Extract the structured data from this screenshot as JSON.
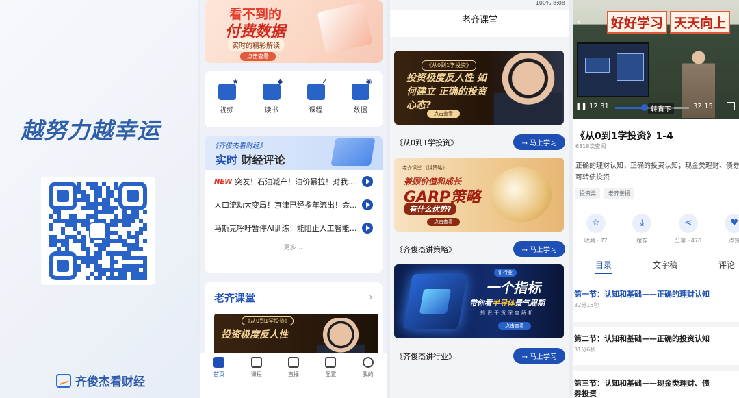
{
  "panel1": {
    "slogan": "越努力越幸运",
    "brand_name": "齐俊杰看财经"
  },
  "panel2": {
    "banner": {
      "line1": "看不到的",
      "line2": "付费数据",
      "line3": "实时的精彩解读",
      "button": "点击查看"
    },
    "icons": [
      {
        "label": "视频",
        "icon": "video-icon"
      },
      {
        "label": "读书",
        "icon": "book-icon"
      },
      {
        "label": "课程",
        "icon": "course-icon"
      },
      {
        "label": "数据",
        "icon": "data-icon"
      }
    ],
    "news": {
      "tag": "《齐俊杰看财经》",
      "title_highlight": "实时",
      "title_rest": "财经评论",
      "new_badge": "NEW",
      "items": [
        "突发！石油减产！油价暴拉！对我...",
        "人口流动大变局！京津已经多年流出！会...",
        "马斯克呼吁暂停AI训练！能阻止人工智能..."
      ],
      "more": "更多"
    },
    "laoqi": {
      "title": "老齐课堂",
      "thumb_tag": "《从0到1学投资》",
      "thumb_text": "投资极度反人性"
    },
    "tabbar": [
      {
        "label": "首页",
        "active": true
      },
      {
        "label": "课程",
        "active": false
      },
      {
        "label": "直播",
        "active": false
      },
      {
        "label": "配置",
        "active": false
      },
      {
        "label": "我的",
        "active": false
      }
    ]
  },
  "panel3": {
    "status": "100% 8:08",
    "title": "老齐课堂",
    "courses": [
      {
        "name": "《从0到1学投资》",
        "button": "→ 马上学习",
        "thumb_tag": "《从0到1学投资》",
        "thumb_text": "投资极度反人性 如何建立 正确的投资心态?",
        "thumb_btn": "点击查看"
      },
      {
        "name": "《齐俊杰讲策略》",
        "button": "→ 马上学习",
        "thumb_tag": "老齐课堂 《讲策略》",
        "thumb_a": "兼顾价值和成长",
        "thumb_b": "GARP策略",
        "thumb_c": "有什么优势?",
        "thumb_btn": "点击查看"
      },
      {
        "name": "《齐俊杰讲行业》",
        "button": "→ 马上学习",
        "thumb_tag": "讲行业",
        "thumb_a": "一个指标",
        "thumb_b_pre": "带你看",
        "thumb_b_hl": "半导体",
        "thumb_b_post": "景气周期",
        "thumb_c": "知识干货深度解析",
        "thumb_btn": "点击查看"
      }
    ]
  },
  "panel4": {
    "video": {
      "banner_words": [
        "好好学习",
        "天天向上"
      ],
      "current": "12:31",
      "total": "32:15",
      "turn": "转直下"
    },
    "course_title": "《从0到1学投资》1-4",
    "views": "6318次查阅",
    "desc": "正确的理财认知；正确的投资认知；现金类理财、债券投资；可转债投资",
    "tags": [
      "投资类",
      "老齐亲授"
    ],
    "actions": [
      {
        "label": "收藏 · 77",
        "icon": "star-icon"
      },
      {
        "label": "缓存",
        "icon": "download-icon"
      },
      {
        "label": "分享 · 470",
        "icon": "share-icon"
      },
      {
        "label": "点赞",
        "icon": "like-icon"
      }
    ],
    "tabs": [
      "目录",
      "文字稿",
      "评论"
    ],
    "lessons": [
      {
        "title": "第一节：认知和基础——正确的理财认知",
        "duration": "32分15秒"
      },
      {
        "title": "第二节：认知和基础——正确的投资认知",
        "duration": "31分6秒"
      },
      {
        "title": "第三节：认知和基础——现金类理财、债",
        "title2": "券投资"
      }
    ]
  }
}
